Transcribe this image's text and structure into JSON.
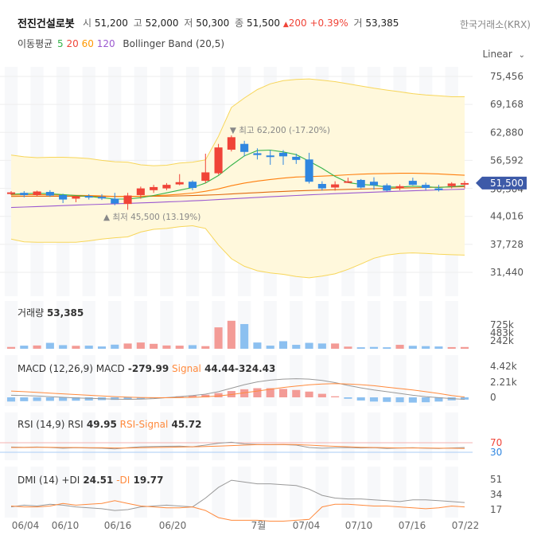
{
  "header": {
    "stock_name": "전진건설로봇",
    "open_label": "시",
    "open": "51,200",
    "high_label": "고",
    "high": "52,000",
    "low_label": "저",
    "low": "50,300",
    "close_label": "종",
    "close": "51,500",
    "change": "200",
    "change_pct": "+0.39%",
    "volume_label": "거",
    "volume": "53,385",
    "exchange": "한국거래소(KRX)",
    "ma_label": "이동평균",
    "ma_periods": [
      "5",
      "20",
      "60",
      "120"
    ],
    "bb_label": "Bollinger Band (20,5)",
    "scale_mode": "Linear"
  },
  "colors": {
    "up": "#f04438",
    "down": "#2f86e0",
    "ma5": "#35b34a",
    "ma20": "#ff7f0e",
    "ma60": "#e06a10",
    "ma120": "#9b59d0",
    "bb_fill": "#fff8dc",
    "bb_line": "#f7d65a",
    "price_tag": "#3d5aa8"
  },
  "chart_data": {
    "type": "candlestick",
    "x_tick_labels": [
      "06/04",
      "06/10",
      "06/16",
      "06/20",
      "7월",
      "07/04",
      "07/10",
      "07/16",
      "07/22"
    ],
    "price_panel": {
      "y_ticks": [
        "75,456",
        "69,168",
        "62,880",
        "56,592",
        "44,016",
        "37,728",
        "31,440"
      ],
      "current_price_tag": "51,500",
      "hidden_tick": "50,304",
      "max_annotation": "▼ 최고 62,200 (-17.20%)",
      "min_annotation": "▲ 최저 45,500 (13.19%)",
      "candles": [
        [
          49200,
          49700,
          48800,
          49400
        ],
        [
          49300,
          49700,
          48300,
          48800
        ],
        [
          48800,
          49800,
          48500,
          49600
        ],
        [
          49500,
          49900,
          48400,
          48700
        ],
        [
          48800,
          49100,
          47000,
          47800
        ],
        [
          48000,
          48700,
          47200,
          48500
        ],
        [
          48600,
          49000,
          47800,
          48300
        ],
        [
          48400,
          49000,
          47700,
          48100
        ],
        [
          48000,
          49300,
          46500,
          46900
        ],
        [
          46800,
          49300,
          45500,
          48700
        ],
        [
          48800,
          50700,
          48000,
          50300
        ],
        [
          49900,
          51100,
          49300,
          50600
        ],
        [
          50300,
          51500,
          49900,
          51100
        ],
        [
          51200,
          53500,
          51000,
          51700
        ],
        [
          51800,
          52100,
          49900,
          50400
        ],
        [
          52000,
          58100,
          51500,
          53900
        ],
        [
          53700,
          60300,
          53400,
          59500
        ],
        [
          59000,
          62200,
          58600,
          61800
        ],
        [
          60300,
          61000,
          57500,
          58500
        ],
        [
          58200,
          59300,
          56800,
          57800
        ],
        [
          57700,
          58900,
          55600,
          57600
        ],
        [
          58300,
          58900,
          55600,
          57500
        ],
        [
          57400,
          58100,
          55800,
          56700
        ],
        [
          56800,
          58300,
          51400,
          51800
        ],
        [
          51300,
          51900,
          49800,
          50300
        ],
        [
          50500,
          51900,
          49800,
          51200
        ],
        [
          51700,
          52700,
          51500,
          51900
        ],
        [
          52200,
          52400,
          50300,
          50500
        ],
        [
          51800,
          52800,
          50000,
          51000
        ],
        [
          51000,
          51400,
          49600,
          49800
        ],
        [
          50400,
          51200,
          49900,
          50800
        ],
        [
          52000,
          52700,
          51000,
          51100
        ],
        [
          51100,
          51600,
          49900,
          50400
        ],
        [
          50300,
          51100,
          49600,
          49900
        ],
        [
          50800,
          51700,
          50300,
          51400
        ],
        [
          51200,
          52000,
          50300,
          51500
        ]
      ],
      "ma5": [
        49000,
        49100,
        49200,
        49100,
        48900,
        48700,
        48500,
        48200,
        47900,
        47900,
        48200,
        48700,
        49300,
        49900,
        50500,
        51500,
        53200,
        55500,
        57600,
        58800,
        58900,
        58500,
        57900,
        56400,
        54800,
        53000,
        51600,
        51200,
        51000,
        50600,
        50600,
        50800,
        50700,
        50500,
        50700,
        50900
      ],
      "ma20": [
        48800,
        48850,
        48900,
        48850,
        48800,
        48750,
        48700,
        48600,
        48500,
        48500,
        48550,
        48650,
        48800,
        49000,
        49250,
        49650,
        50200,
        50900,
        51500,
        51950,
        52300,
        52600,
        52850,
        52950,
        53050,
        53200,
        53350,
        53500,
        53600,
        53650,
        53700,
        53700,
        53650,
        53550,
        53400,
        53250
      ],
      "ma60": [
        48500,
        48520,
        48540,
        48550,
        48550,
        48540,
        48520,
        48500,
        48490,
        48490,
        48500,
        48520,
        48560,
        48610,
        48680,
        48770,
        48890,
        49040,
        49200,
        49350,
        49490,
        49620,
        49740,
        49830,
        49920,
        50000,
        50080,
        50160,
        50230,
        50300,
        50370,
        50440,
        50500,
        50560,
        50620,
        50680
      ],
      "ma120": [
        46000,
        46110,
        46220,
        46330,
        46440,
        46540,
        46640,
        46740,
        46840,
        46940,
        47040,
        47140,
        47250,
        47370,
        47500,
        47640,
        47790,
        47950,
        48110,
        48270,
        48420,
        48570,
        48710,
        48850,
        48980,
        49110,
        49230,
        49350,
        49460,
        49570,
        49670,
        49770,
        49860,
        49950,
        50040,
        50120
      ],
      "bb_upper": [
        57800,
        57400,
        57200,
        57300,
        57300,
        57200,
        57000,
        56600,
        56300,
        56200,
        55600,
        55400,
        55500,
        56000,
        56200,
        56700,
        62000,
        68500,
        70600,
        72500,
        73800,
        74500,
        74800,
        74900,
        74600,
        74300,
        73800,
        73300,
        72800,
        72400,
        72000,
        71600,
        71300,
        71100,
        70900,
        70900
      ],
      "bb_lower": [
        38900,
        38300,
        38200,
        38200,
        38200,
        38200,
        38500,
        38900,
        39200,
        39400,
        40500,
        41100,
        41300,
        41700,
        41900,
        41300,
        37600,
        34500,
        32800,
        31800,
        31300,
        31000,
        30500,
        30200,
        30600,
        31100,
        32100,
        33300,
        34600,
        35300,
        35700,
        35800,
        35700,
        35500,
        35400,
        35300
      ]
    },
    "volume_panel": {
      "label": "거래량",
      "value": "53,385",
      "y_ticks": [
        "725k",
        "483k",
        "242k"
      ],
      "values": [
        55000,
        95000,
        100000,
        180000,
        110000,
        90000,
        95000,
        70000,
        125000,
        160000,
        190000,
        150000,
        100000,
        95000,
        110000,
        80000,
        650000,
        850000,
        750000,
        190000,
        95000,
        230000,
        120000,
        180000,
        160000,
        160000,
        65000,
        45000,
        55000,
        45000,
        120000,
        90000,
        80000,
        70000,
        50000,
        53385
      ]
    },
    "macd_panel": {
      "label": "MACD (12,26,9)",
      "macd_label": "MACD",
      "macd_value": "-279.99",
      "signal_label": "Signal",
      "signal_value": "44.44",
      "hist_value": "-324.43",
      "y_ticks": [
        "4.42k",
        "2.21k",
        "0"
      ],
      "macd": [
        300,
        250,
        180,
        100,
        0,
        -80,
        -150,
        -200,
        -260,
        -280,
        -260,
        -180,
        -50,
        100,
        250,
        450,
        800,
        1300,
        1800,
        2200,
        2450,
        2600,
        2650,
        2600,
        2400,
        2100,
        1700,
        1350,
        1050,
        800,
        550,
        300,
        100,
        -50,
        -180,
        -280
      ],
      "signal": [
        900,
        800,
        700,
        600,
        500,
        400,
        300,
        200,
        100,
        30,
        -20,
        -50,
        -60,
        -50,
        0,
        80,
        200,
        400,
        650,
        900,
        1150,
        1400,
        1600,
        1780,
        1900,
        1950,
        1900,
        1800,
        1650,
        1450,
        1250,
        1050,
        800,
        550,
        250,
        44
      ]
    },
    "rsi_panel": {
      "label": "RSI (14,9)",
      "rsi_label": "RSI",
      "rsi_value": "49.95",
      "signal_label": "RSI-Signal",
      "signal_value": "45.72",
      "y_ticks": [
        "70",
        "30"
      ],
      "rsi": [
        52,
        51,
        52,
        50,
        47,
        49,
        48,
        47,
        44,
        49,
        53,
        54,
        55,
        56,
        53,
        60,
        68,
        72,
        65,
        63,
        62,
        62,
        60,
        50,
        47,
        49,
        50,
        48,
        49,
        46,
        48,
        49,
        47,
        46,
        48,
        50
      ],
      "signal": [
        50,
        50,
        51,
        51,
        50,
        50,
        49,
        49,
        48,
        48,
        49,
        50,
        51,
        52,
        53,
        54,
        56,
        58,
        60,
        62,
        62,
        63,
        62,
        60,
        57,
        55,
        53,
        51,
        50,
        49,
        48,
        48,
        48,
        47,
        47,
        46
      ]
    },
    "dmi_panel": {
      "label": "DMI (14)",
      "pdi_label": "+DI",
      "pdi_value": "24.51",
      "mdi_label": "-DI",
      "mdi_value": "19.77",
      "y_ticks": [
        "51",
        "34",
        "17"
      ],
      "pdi": [
        20,
        22,
        21,
        23,
        22,
        20,
        19,
        18,
        16,
        17,
        20,
        21,
        22,
        21,
        20,
        30,
        42,
        50,
        48,
        46,
        46,
        45,
        44,
        40,
        33,
        30,
        29,
        29,
        28,
        27,
        26,
        28,
        28,
        27,
        26,
        25
      ],
      "mdi": [
        21,
        20,
        20,
        21,
        24,
        22,
        23,
        24,
        27,
        24,
        21,
        20,
        19,
        19,
        20,
        16,
        8,
        5,
        5,
        5,
        4,
        4,
        5,
        6,
        20,
        23,
        23,
        22,
        21,
        21,
        20,
        19,
        18,
        19,
        21,
        20
      ]
    }
  }
}
